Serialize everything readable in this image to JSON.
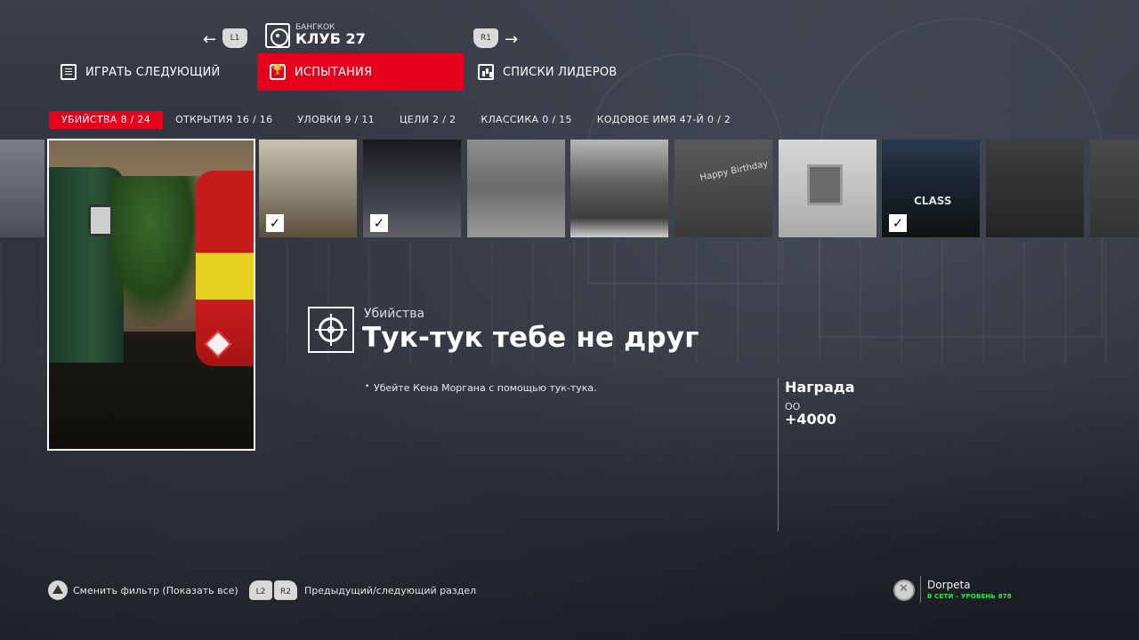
{
  "header": {
    "prev_button": "L1",
    "next_button": "R1",
    "location_city": "БАНГКОК",
    "location_name": "КЛУБ 27"
  },
  "tabs": [
    {
      "label": "ИГРАТЬ СЛЕДУЮЩИЙ",
      "icon": "list-icon",
      "active": false
    },
    {
      "label": "ИСПЫТАНИЯ",
      "icon": "trophy-icon",
      "active": true
    },
    {
      "label": "СПИСКИ ЛИДЕРОВ",
      "icon": "leaderboard-icon",
      "active": false
    }
  ],
  "filters": [
    {
      "label": "УБИЙСТВА",
      "count": "8 / 24",
      "active": true
    },
    {
      "label": "ОТКРЫТИЯ",
      "count": "16 / 16",
      "active": false
    },
    {
      "label": "УЛОВКИ",
      "count": "9 / 11",
      "active": false
    },
    {
      "label": "ЦЕЛИ",
      "count": "2 / 2",
      "active": false
    },
    {
      "label": "КЛАССИКА",
      "count": "0 / 15",
      "active": false
    },
    {
      "label": "КОДОВОЕ ИМЯ 47-Й",
      "count": "0 / 2",
      "active": false
    }
  ],
  "thumbnails": [
    {
      "completed": true
    },
    {
      "completed": true
    },
    {
      "completed": false
    },
    {
      "completed": false
    },
    {
      "completed": false,
      "text": "Happy Birthday"
    },
    {
      "completed": false
    },
    {
      "completed": true,
      "text": "CLASS"
    },
    {
      "completed": false
    }
  ],
  "challenge": {
    "category": "Убийства",
    "title": "Тук-тук тебе не друг",
    "description": "Убейте Кена Моргана с помощью тук-тука.",
    "icon": "crosshair-icon"
  },
  "reward": {
    "title": "Награда",
    "unit": "ОО",
    "value": "+4000"
  },
  "hints": {
    "filter_button": "△",
    "filter_label": "Сменить фильтр (Показать все)",
    "section_buttons": [
      "L2",
      "R2"
    ],
    "section_label": "Предыдущий/следующий раздел"
  },
  "profile": {
    "name": "Dorpeta",
    "status": "В СЕТИ - УРОВЕНЬ 878"
  },
  "colors": {
    "accent": "#e6001c",
    "online": "#3ce04c"
  }
}
